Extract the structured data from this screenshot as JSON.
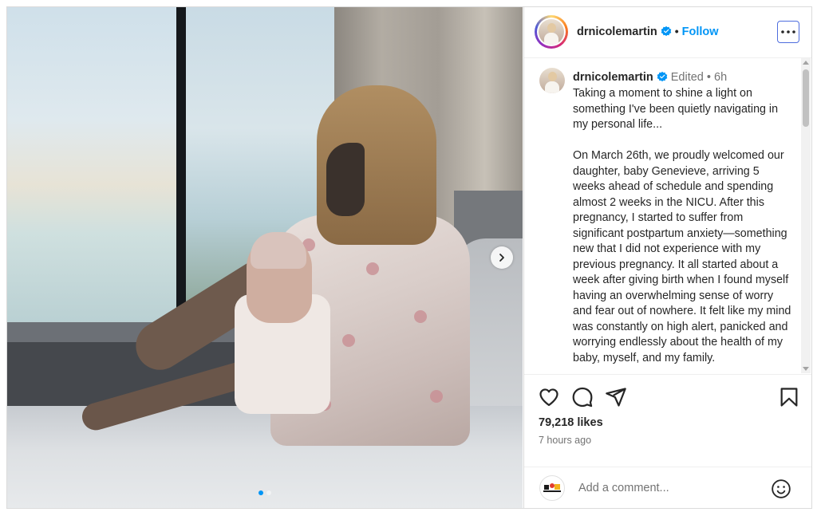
{
  "post": {
    "username": "drnicolemartin",
    "follow_label": "Follow",
    "separator": "•",
    "edited_label": "Edited",
    "time_ago": "6h",
    "caption": "Taking a moment to shine a light on something I've been quietly navigating in my personal life...\n\nOn March 26th, we proudly welcomed our daughter, baby Genevieve, arriving 5 weeks ahead of schedule and spending almost 2 weeks in the NICU. After this pregnancy, I started to suffer from significant postpartum anxiety—something new that I did not experience with my previous pregnancy. It all started about a week after giving birth when I found myself having an overwhelming sense of worry and fear out of nowhere. It felt like my mind was constantly on high alert, panicked and worrying endlessly about the health of my baby, myself, and my family.",
    "likes": "79,218 likes",
    "posted": "7 hours ago"
  },
  "carousel": {
    "count": 2,
    "active": 0
  },
  "comment": {
    "placeholder": "Add a comment..."
  },
  "icons": {
    "more": "more-options-icon",
    "verified": "verified-badge-icon",
    "like": "heart-icon",
    "comment": "comment-icon",
    "share": "share-icon",
    "save": "bookmark-icon",
    "emoji": "emoji-icon",
    "next": "chevron-right-icon"
  },
  "colors": {
    "accent": "#0095f6",
    "text": "#262626",
    "muted": "#737373"
  }
}
